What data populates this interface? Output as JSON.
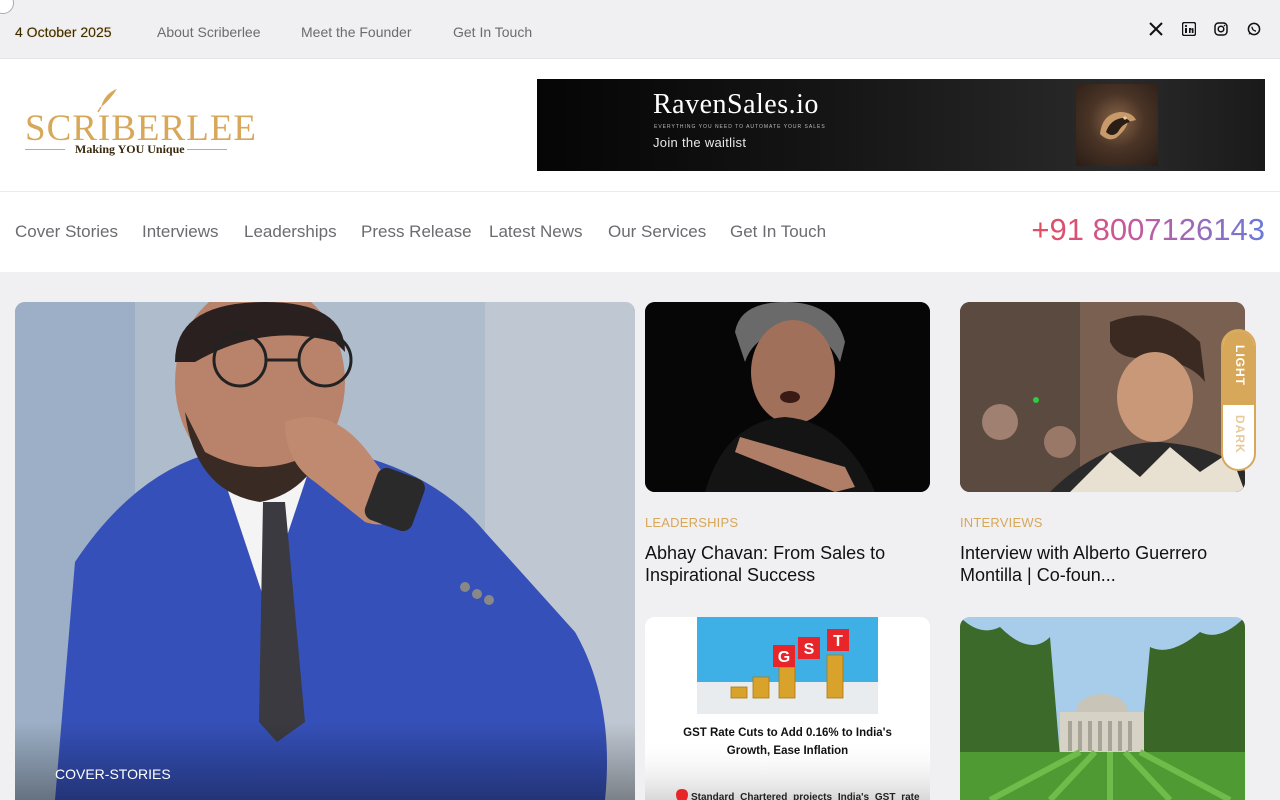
{
  "topbar": {
    "date": "4 October 2025",
    "links": [
      "About Scriberlee",
      "Meet the Founder",
      "Get In Touch"
    ]
  },
  "social": [
    "x-icon",
    "linkedin-icon",
    "instagram-icon",
    "whatsapp-icon"
  ],
  "logo": {
    "name": "SCRIBERLEE",
    "tagline": "Making YOU Unique"
  },
  "banner": {
    "title": "RavenSales.io",
    "subtitle": "EVERYTHING YOU NEED TO AUTOMATE YOUR SALES",
    "cta": "Join the waitlist"
  },
  "nav": {
    "items": [
      "Cover Stories",
      "Interviews",
      "Leaderships",
      "Press Release",
      "Latest News",
      "Our Services",
      "Get In Touch"
    ],
    "phone": "+91 8007126143"
  },
  "hero": {
    "category": "COVER-STORIES"
  },
  "cards": [
    {
      "category": "LEADERSHIPS",
      "title": "Abhay Chavan: From Sales to Inspirational Success"
    },
    {
      "category": "INTERVIEWS",
      "title": "Interview with Alberto Guerrero Montilla | Co-foun..."
    }
  ],
  "gst_card": {
    "letters": [
      "G",
      "S",
      "T"
    ],
    "headline": "GST Rate Cuts to Add 0.16% to India's Growth, Ease Inflation",
    "snippet": "Standard Chartered projects India's GST rate"
  },
  "theme_toggle": {
    "light": "LIGHT",
    "dark": "DARK"
  },
  "colors": {
    "gold": "#d7a75a",
    "nav_text": "#6b6b70",
    "phone_start": "#e74c5a",
    "phone_end": "#6a7ad8"
  }
}
